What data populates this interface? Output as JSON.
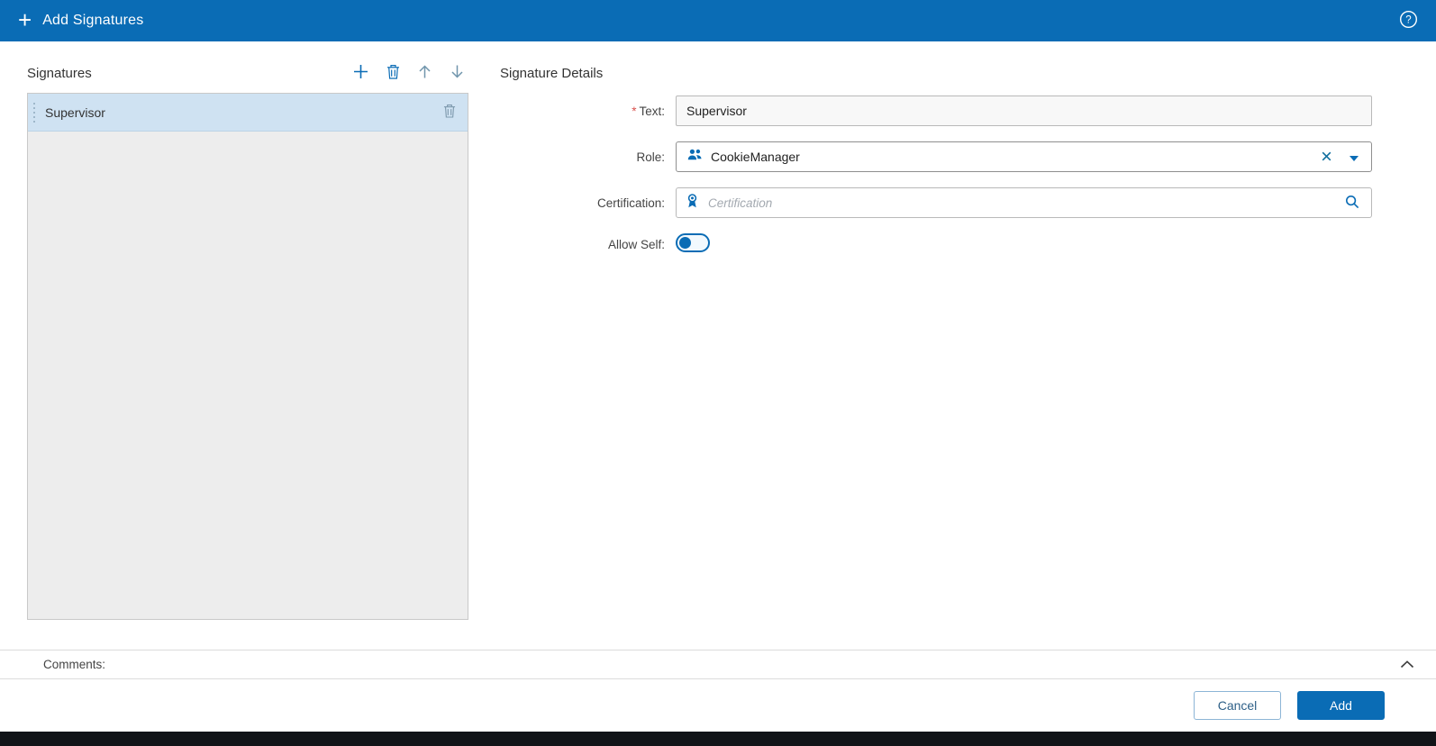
{
  "colors": {
    "accent": "#0a6cb5",
    "header_bg": "#0a6cb5",
    "selected_item_bg": "#cfe2f2",
    "required_marker_color": "#d9534f"
  },
  "header": {
    "title": "Add Signatures"
  },
  "signatures_panel": {
    "title": "Signatures",
    "items": [
      {
        "label": "Supervisor",
        "selected": true
      }
    ]
  },
  "details": {
    "title": "Signature Details",
    "text_field": {
      "label": "Text:",
      "required_marker": "*",
      "value": "Supervisor"
    },
    "role_field": {
      "label": "Role:",
      "value": "CookieManager"
    },
    "certification_field": {
      "label": "Certification:",
      "placeholder": "Certification",
      "value": ""
    },
    "allow_self_field": {
      "label": "Allow Self:",
      "state": "off"
    }
  },
  "comments": {
    "label": "Comments:"
  },
  "footer": {
    "cancel_label": "Cancel",
    "add_label": "Add"
  }
}
